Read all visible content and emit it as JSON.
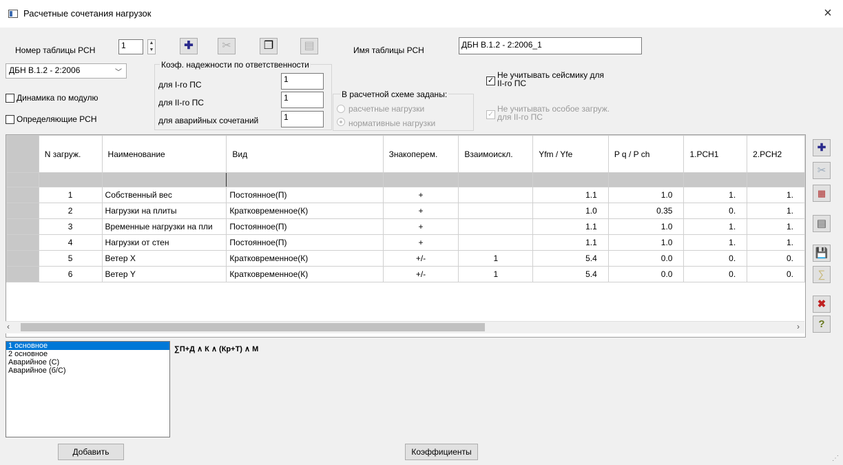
{
  "window": {
    "title": "Расчетные сочетания нагрузок",
    "close": "×"
  },
  "top": {
    "table_number_label": "Номер таблицы РСН",
    "table_number_value": "1",
    "table_name_label": "Имя таблицы РСН",
    "table_name_value": "ДБН В.1.2 - 2:2006_1",
    "norm_combo_value": "ДБН В.1.2 - 2:2006",
    "dynamics_label": "Динамика по модулю",
    "defining_label": "Определяющие РСН",
    "coef_group_title": "Коэф. надежности по ответственности",
    "coef_rows": [
      {
        "label": "для I-го ПС",
        "value": "1"
      },
      {
        "label": "для II-го ПС",
        "value": "1"
      },
      {
        "label": "для аварийных сочетаний",
        "value": "1"
      }
    ],
    "scheme_group_title": "В расчетной схеме заданы:",
    "scheme_opt1": "расчетные нагрузки",
    "scheme_opt2": "нормативные нагрузки",
    "seismic_label_1": "Не учитывать сейсмику для",
    "seismic_label_2": "II-го ПС",
    "special_label_1": "Не учитывать особое загруж.",
    "special_label_2": "для II-го ПС"
  },
  "grid": {
    "headers": [
      "N загруж.",
      "Наименование",
      "Вид",
      "Знакоперем.",
      "Взаимоискл.",
      "Yfm / Yfe",
      "P q / P ch",
      "1.PCH1",
      "2.PCH2"
    ],
    "rows": [
      [
        "1",
        "Собственный вес",
        "Постоянное(П)",
        "+",
        "",
        "1.1",
        "1.0",
        "1.",
        "1."
      ],
      [
        "2",
        "Нагрузки на плиты",
        "Кратковременное(К)",
        "+",
        "",
        "1.0",
        "0.35",
        "0.",
        "1."
      ],
      [
        "3",
        "Временные нагрузки на пли",
        "Постоянное(П)",
        "+",
        "",
        "1.1",
        "1.0",
        "1.",
        "1."
      ],
      [
        "4",
        "Нагрузки от стен",
        "Постоянное(П)",
        "+",
        "",
        "1.1",
        "1.0",
        "1.",
        "1."
      ],
      [
        "5",
        "Ветер X",
        "Кратковременное(К)",
        "+/-",
        "1",
        "5.4",
        "0.0",
        "0.",
        "0."
      ],
      [
        "6",
        "Ветер Y",
        "Кратковременное(К)",
        "+/-",
        "1",
        "5.4",
        "0.0",
        "0.",
        "0."
      ]
    ]
  },
  "combos": {
    "items": [
      "1 основное",
      "2 основное",
      "Аварийное (С)",
      "Аварийное (б/С)"
    ],
    "selected_index": 0,
    "formula": "∑П+Д ∧ К ∧ (Кр+Т) ∧ М"
  },
  "buttons": {
    "add": "Добавить",
    "coefficients": "Коэффициенты"
  },
  "icons": {
    "add": "plus-icon",
    "cut": "scissors-icon",
    "copy": "copy-icon",
    "paste": "paste-icon",
    "delete_table": "delete-table-icon",
    "save": "save-icon",
    "sum": "sum-icon",
    "delete": "delete-icon",
    "help": "help-icon"
  }
}
